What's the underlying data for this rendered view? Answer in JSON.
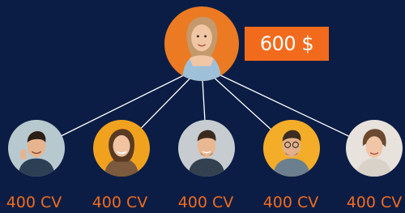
{
  "top": {
    "price": "600 $",
    "avatar_bg": "#ec7a22"
  },
  "children": [
    {
      "label": "400 CV",
      "bg": "#b7c9cf",
      "shirt": "#2c3f55",
      "skin": "#e8b48d",
      "hair": "#2a1d14"
    },
    {
      "label": "400 CV",
      "bg": "#f0a21f",
      "shirt": "#7b5a3e",
      "skin": "#f1c3a0",
      "hair": "#5a3a22"
    },
    {
      "label": "400 CV",
      "bg": "#c7ccd0",
      "shirt": "#33404f",
      "skin": "#e9b893",
      "hair": "#3a2a1d"
    },
    {
      "label": "400 CV",
      "bg": "#f4ad28",
      "shirt": "#6c7f8f",
      "skin": "#e4b089",
      "hair": "#3c2c22"
    },
    {
      "label": "400 CV",
      "bg": "#e7e2dc",
      "shirt": "#d9d2c9",
      "skin": "#f0c6a6",
      "hair": "#6b4a30"
    }
  ],
  "colors": {
    "background": "#0b1d45",
    "accent": "#f26b1d",
    "connector": "#ffffff"
  }
}
